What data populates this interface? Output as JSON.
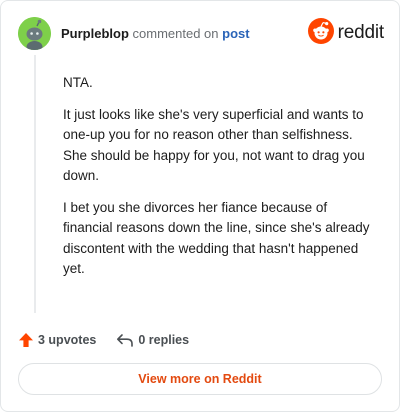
{
  "header": {
    "username": "Purpleblop",
    "commented_text": "commented on",
    "post_link": "post",
    "brand": "reddit"
  },
  "comment": {
    "paragraphs": [
      "NTA.",
      "It just looks like she's very superficial and wants to one-up you for no reason other than selfishness. She should be happy for you, not want to drag you down.",
      "I bet you she divorces her fiance because of financial reasons down the line, since she's already discontent with the wedding that hasn't happened yet."
    ]
  },
  "actions": {
    "upvotes": "3 upvotes",
    "replies": "0 replies"
  },
  "footer": {
    "view_more": "View more on Reddit"
  },
  "colors": {
    "avatar_bg": "#7ed04a",
    "accent": "#ff4500",
    "link": "#2a64b8",
    "view_more_text": "#e34a10"
  },
  "icons": {
    "avatar": "snoo-avatar-icon",
    "brand": "reddit-logo-icon",
    "upvote": "upvote-arrow-icon",
    "reply": "reply-arrow-icon"
  }
}
